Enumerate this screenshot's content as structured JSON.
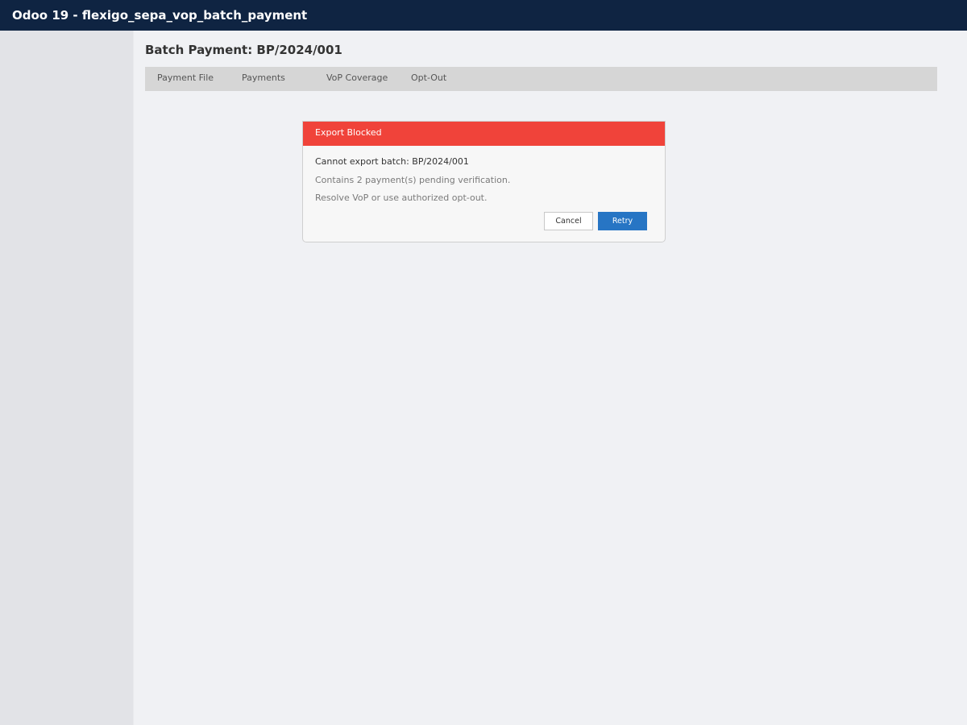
{
  "app": {
    "title": "Odoo 19 - flexigo_sepa_vop_batch_payment"
  },
  "page": {
    "title": "Batch Payment: BP/2024/001"
  },
  "tabs": [
    {
      "label": "Payment File"
    },
    {
      "label": "Payments"
    },
    {
      "label": "VoP Coverage"
    },
    {
      "label": "Opt-Out"
    }
  ],
  "dialog": {
    "title": "Export Blocked",
    "message": "Cannot export batch: BP/2024/001",
    "detail": "Contains 2 payment(s) pending verification.",
    "hint": "Resolve VoP or use authorized opt-out.",
    "cancel_label": "Cancel",
    "retry_label": "Retry"
  },
  "colors": {
    "topbar": "#0f2442",
    "dialog_header": "#f0433a",
    "primary_button": "#2775c4"
  }
}
